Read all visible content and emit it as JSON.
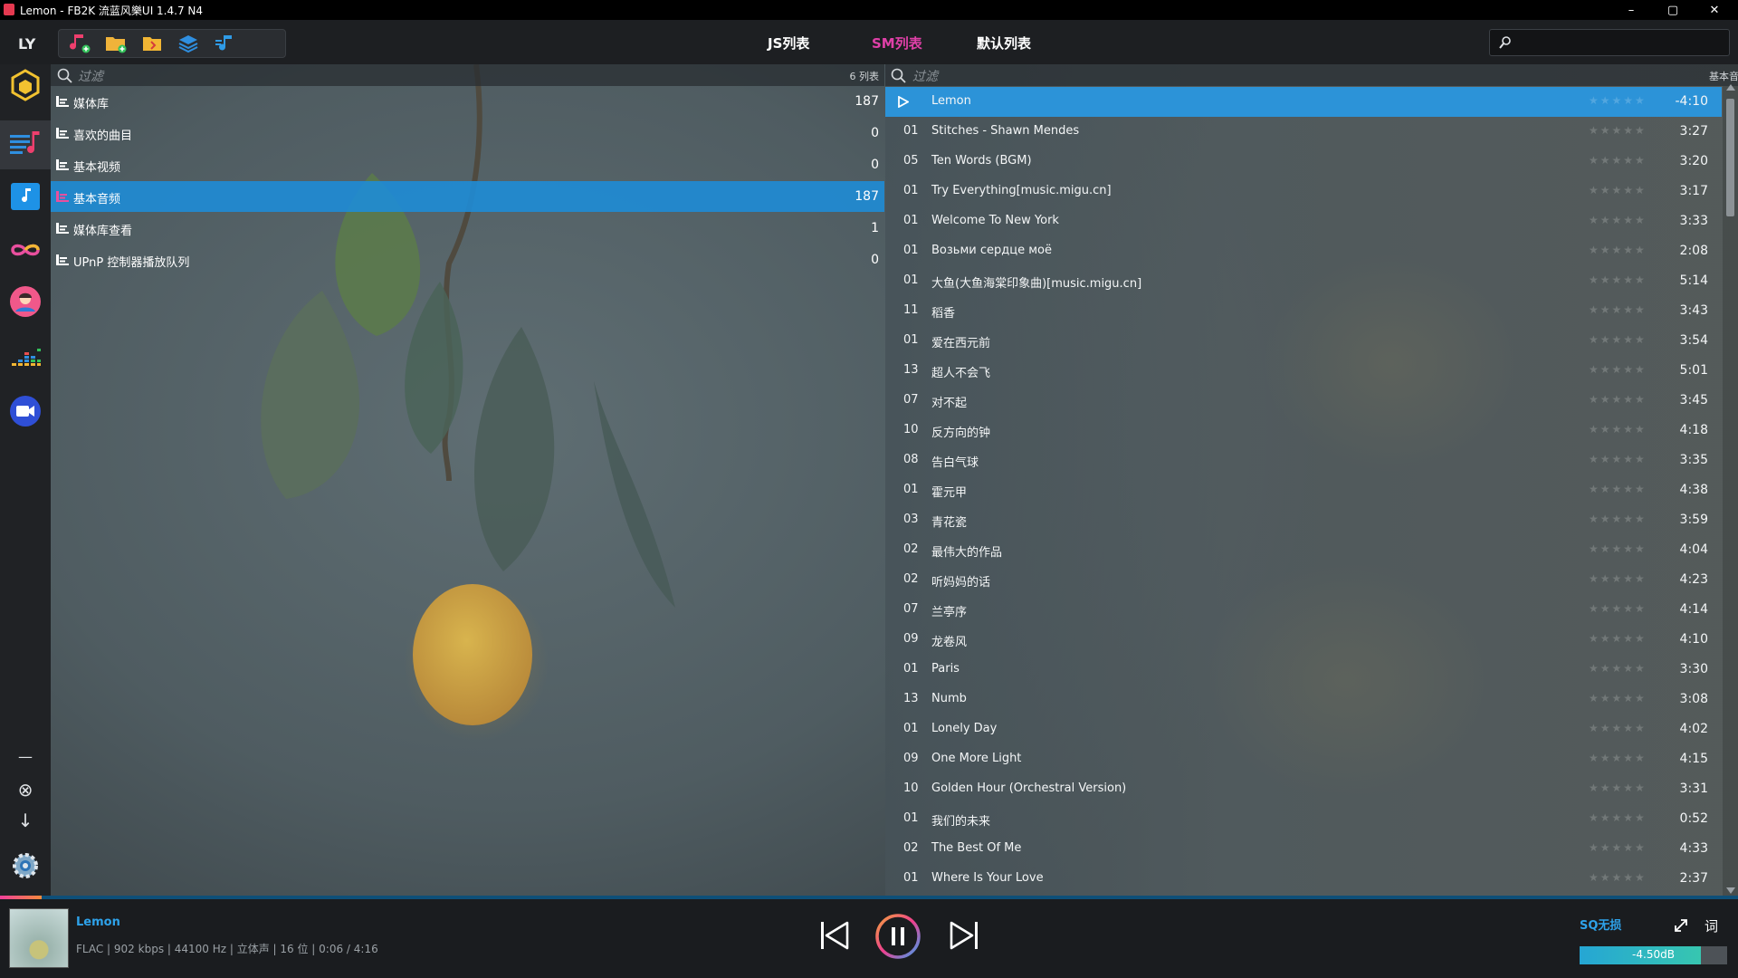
{
  "window": {
    "title": "Lemon - FB2K 流蓝风樂UI 1.4.7 N4",
    "minimize": "–",
    "maximize": "▢",
    "close": "✕"
  },
  "topbar": {
    "logo": "LY",
    "tools": [
      "add-music-icon",
      "add-folder-icon",
      "open-folder-icon",
      "layers-icon",
      "playlist-icon"
    ],
    "tabs": [
      {
        "label": "JS列表",
        "active": false
      },
      {
        "label": "SM列表",
        "active": true
      },
      {
        "label": "默认列表",
        "active": false
      }
    ],
    "search": {
      "placeholder": ""
    }
  },
  "sidebar": {
    "icons": [
      "package-icon",
      "playlist-view-icon",
      "music-note-icon",
      "infinity-icon",
      "avatar-icon",
      "equalizer-icon",
      "video-icon"
    ],
    "bottom": [
      "minimize-line-icon",
      "close-circle-icon",
      "download-arrow-icon",
      "settings-gear-icon"
    ],
    "minimize_glyph": "—",
    "close_glyph": "⊗",
    "down_glyph": "↓"
  },
  "left": {
    "filter_placeholder": "过滤",
    "count_label": "6 列表",
    "playlists": [
      {
        "name": "媒体库",
        "count": "187",
        "active": false
      },
      {
        "name": "喜欢的曲目",
        "count": "0",
        "active": false
      },
      {
        "name": "基本视频",
        "count": "0",
        "active": false
      },
      {
        "name": "基本音频",
        "count": "187",
        "active": true
      },
      {
        "name": "媒体库查看",
        "count": "1",
        "active": false
      },
      {
        "name": "UPnP 控制器播放队列",
        "count": "0",
        "active": false
      }
    ]
  },
  "right": {
    "filter_placeholder": "过滤",
    "list_label": "基本音频",
    "stars": "★★★★★",
    "tracks": [
      {
        "no": "",
        "title": "Lemon",
        "dur": "-4:10",
        "playing": true
      },
      {
        "no": "01",
        "title": "Stitches - Shawn Mendes",
        "dur": "3:27"
      },
      {
        "no": "05",
        "title": "Ten Words (BGM)",
        "dur": "3:20"
      },
      {
        "no": "01",
        "title": "Try Everything[music.migu.cn]",
        "dur": "3:17"
      },
      {
        "no": "01",
        "title": "Welcome To New York",
        "dur": "3:33"
      },
      {
        "no": "01",
        "title": "Возьми сердце моё",
        "dur": "2:08"
      },
      {
        "no": "01",
        "title": "大鱼(大鱼海棠印象曲)[music.migu.cn]",
        "dur": "5:14"
      },
      {
        "no": "11",
        "title": "稻香",
        "dur": "3:43"
      },
      {
        "no": "01",
        "title": "爱在西元前",
        "dur": "3:54"
      },
      {
        "no": "13",
        "title": "超人不会飞",
        "dur": "5:01"
      },
      {
        "no": "07",
        "title": "对不起",
        "dur": "3:45"
      },
      {
        "no": "10",
        "title": "反方向的钟",
        "dur": "4:18"
      },
      {
        "no": "08",
        "title": "告白气球",
        "dur": "3:35"
      },
      {
        "no": "01",
        "title": "霍元甲",
        "dur": "4:38"
      },
      {
        "no": "03",
        "title": "青花瓷",
        "dur": "3:59"
      },
      {
        "no": "02",
        "title": "最伟大的作品",
        "dur": "4:04"
      },
      {
        "no": "02",
        "title": "听妈妈的话",
        "dur": "4:23"
      },
      {
        "no": "07",
        "title": "兰亭序",
        "dur": "4:14"
      },
      {
        "no": "09",
        "title": "龙卷风",
        "dur": "4:10"
      },
      {
        "no": "01",
        "title": "Paris",
        "dur": "3:30"
      },
      {
        "no": "13",
        "title": "Numb",
        "dur": "3:08"
      },
      {
        "no": "01",
        "title": "Lonely Day",
        "dur": "4:02"
      },
      {
        "no": "09",
        "title": "One More Light",
        "dur": "4:15"
      },
      {
        "no": "10",
        "title": "Golden Hour (Orchestral Version)",
        "dur": "3:31"
      },
      {
        "no": "01",
        "title": "我们的未来",
        "dur": "0:52"
      },
      {
        "no": "02",
        "title": "The Best Of Me",
        "dur": "4:33"
      },
      {
        "no": "01",
        "title": "Where Is Your Love",
        "dur": "2:37"
      }
    ]
  },
  "player": {
    "song": "Lemon",
    "info": "FLAC | 902 kbps | 44100 Hz | 立体声 | 16 位 | 0:06 / 4:16",
    "progress_fraction": 0.024,
    "quality": "SQ无损",
    "lyrics_label": "词",
    "volume_label": "-4.50dB",
    "volume_fraction": 0.82
  },
  "colors": {
    "accent_blue": "#2c93d8",
    "tab_active_pink": "#e040a8",
    "progress_pink": "#f0409b"
  }
}
